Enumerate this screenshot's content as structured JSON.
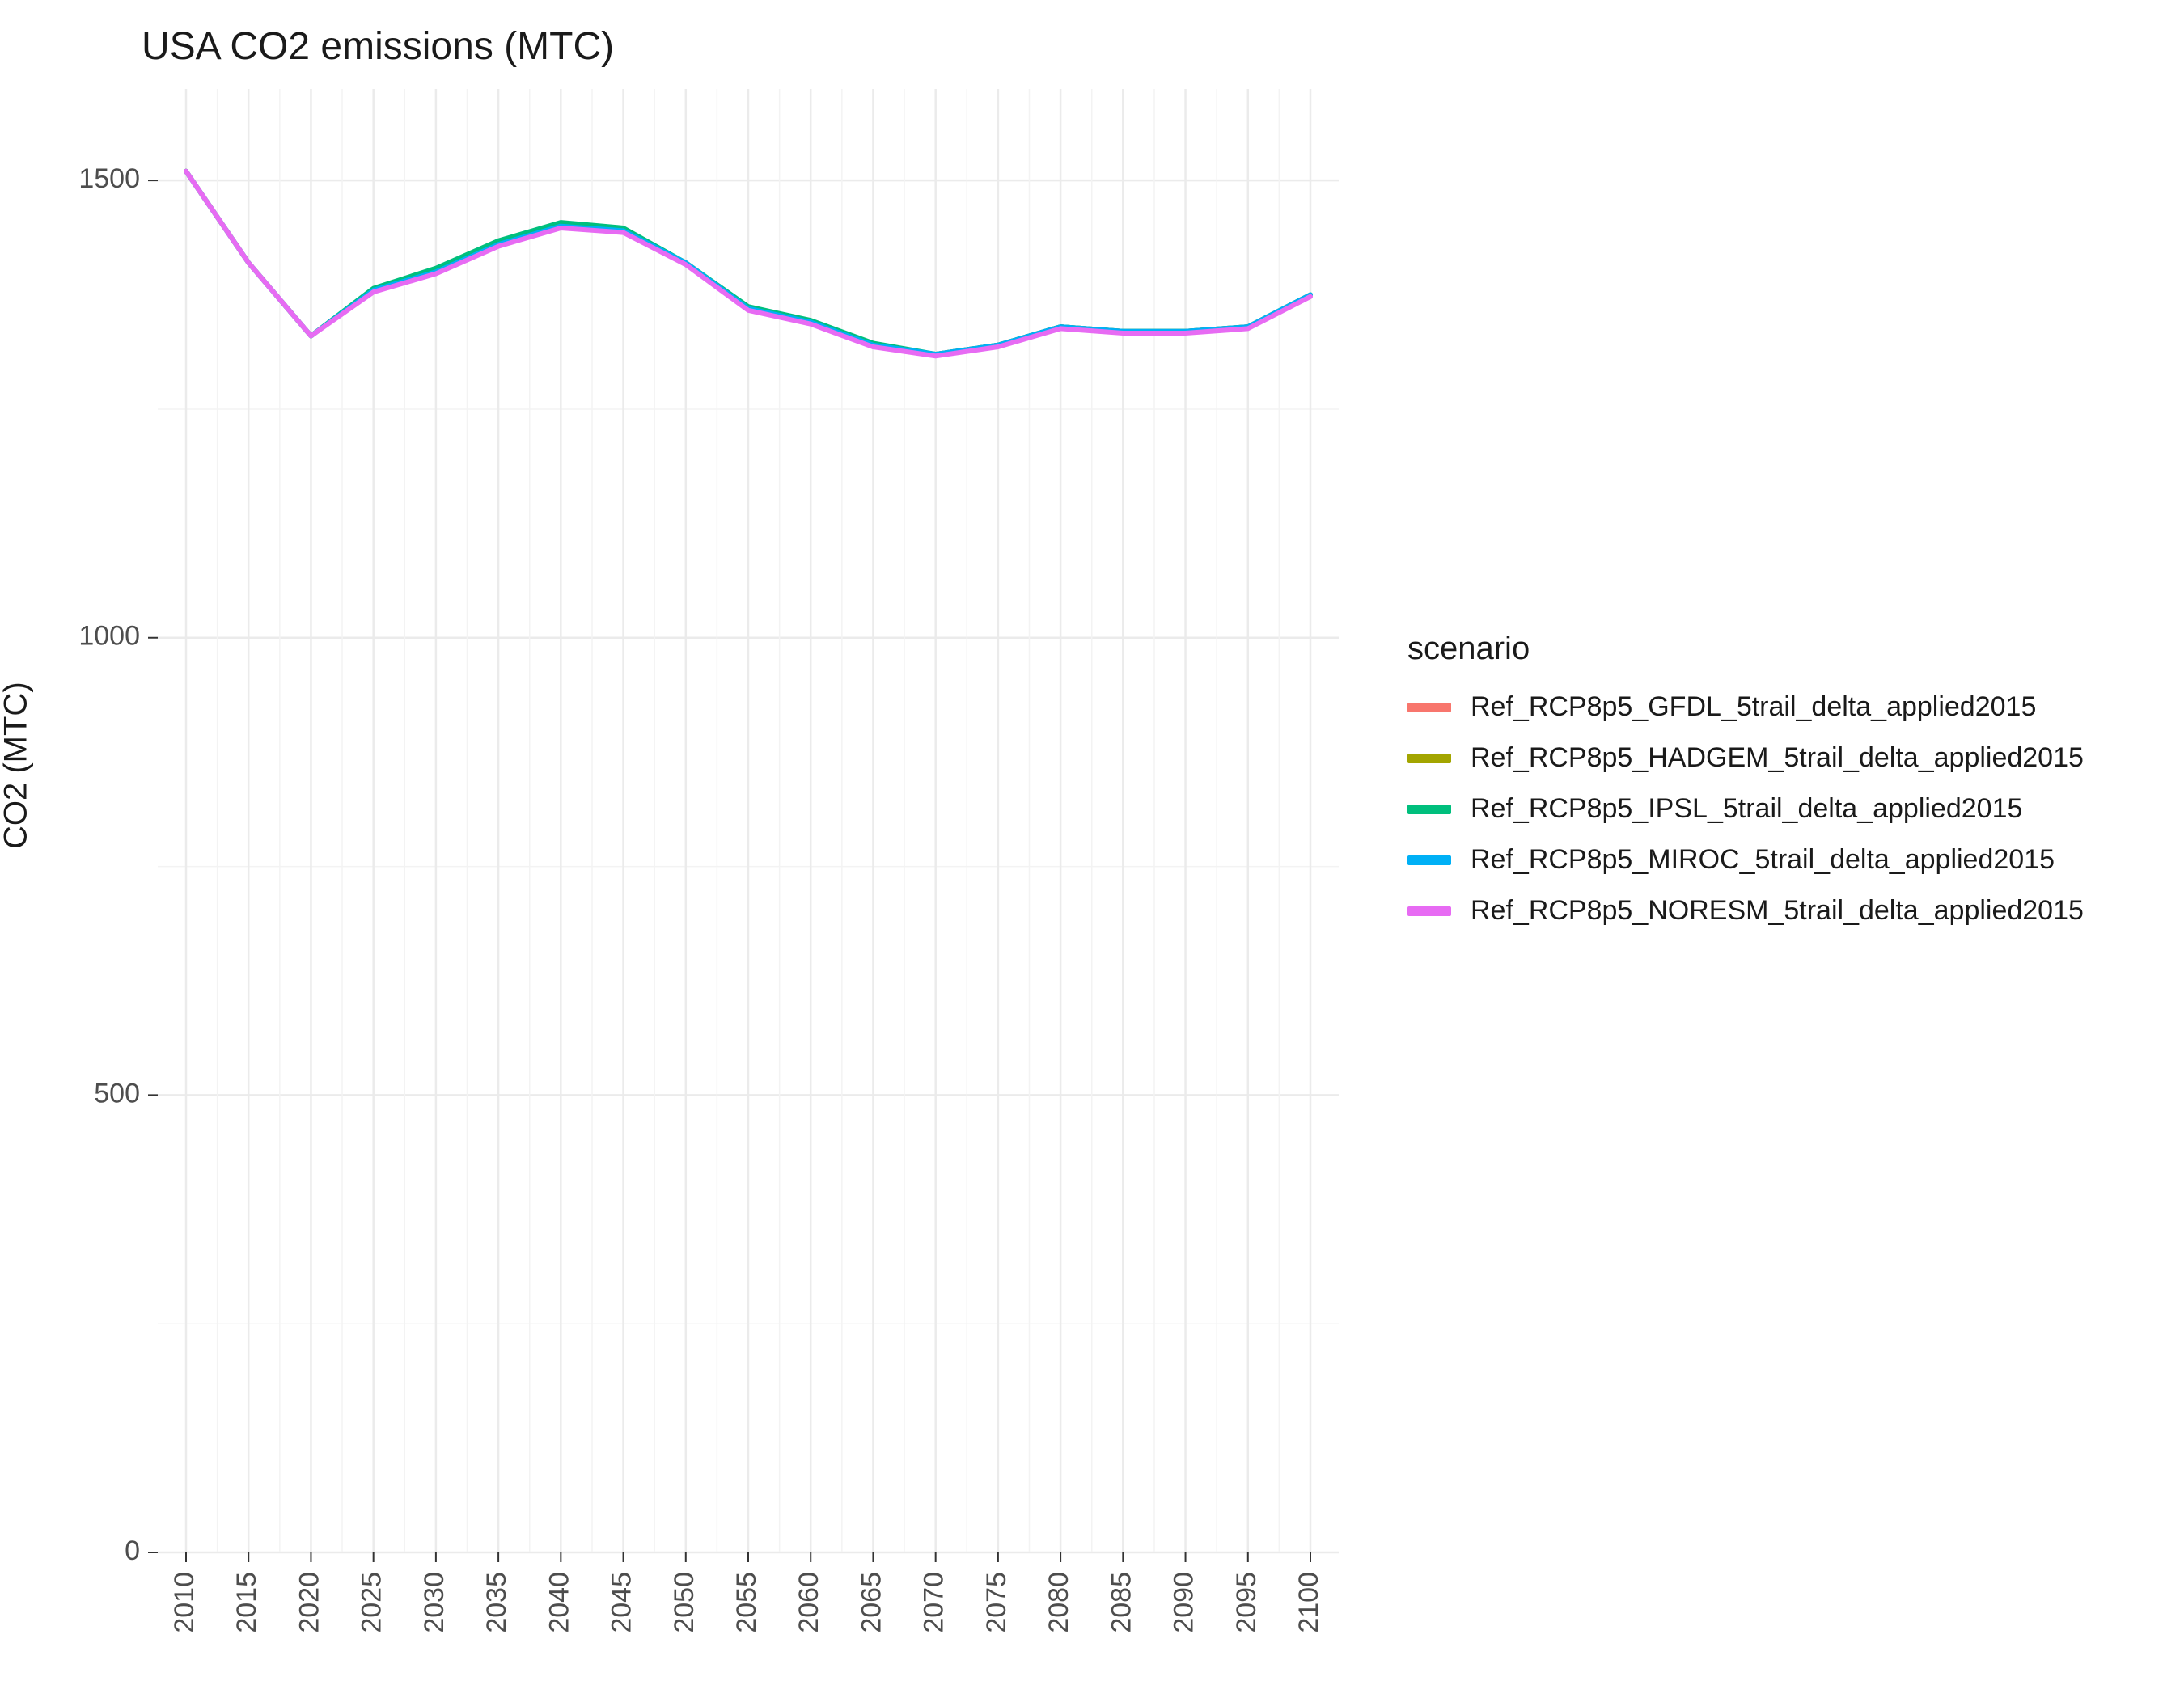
{
  "chart_data": {
    "type": "line",
    "title": "USA CO2 emissions (MTC)",
    "xlabel": "",
    "ylabel": "CO2 (MTC)",
    "ylim": [
      0,
      1600
    ],
    "yticks": [
      0,
      500,
      1000,
      1500
    ],
    "x": [
      2010,
      2015,
      2020,
      2025,
      2030,
      2035,
      2040,
      2045,
      2050,
      2055,
      2060,
      2065,
      2070,
      2075,
      2080,
      2085,
      2090,
      2095,
      2100
    ],
    "legend_title": "scenario",
    "series": [
      {
        "name": "Ref_RCP8p5_GFDL_5trail_delta_applied2015",
        "color": "#F8766D",
        "values": [
          1510,
          1410,
          1330,
          1380,
          1400,
          1430,
          1450,
          1445,
          1410,
          1360,
          1345,
          1320,
          1310,
          1320,
          1340,
          1335,
          1335,
          1340,
          1375
        ]
      },
      {
        "name": "Ref_RCP8p5_HADGEM_5trail_delta_applied2015",
        "color": "#A3A500",
        "values": [
          1510,
          1410,
          1330,
          1380,
          1400,
          1430,
          1450,
          1445,
          1410,
          1360,
          1345,
          1320,
          1310,
          1320,
          1340,
          1335,
          1335,
          1340,
          1375
        ]
      },
      {
        "name": "Ref_RCP8p5_IPSL_5trail_delta_applied2015",
        "color": "#00BF7D",
        "values": [
          1510,
          1410,
          1330,
          1382,
          1404,
          1434,
          1454,
          1448,
          1410,
          1362,
          1347,
          1322,
          1310,
          1320,
          1340,
          1335,
          1335,
          1340,
          1375
        ]
      },
      {
        "name": "Ref_RCP8p5_MIROC_5trail_delta_applied2015",
        "color": "#00B0F6",
        "values": [
          1510,
          1410,
          1330,
          1380,
          1400,
          1430,
          1450,
          1445,
          1410,
          1360,
          1345,
          1320,
          1310,
          1320,
          1340,
          1335,
          1335,
          1340,
          1375
        ]
      },
      {
        "name": "Ref_RCP8p5_NORESM_5trail_delta_applied2015",
        "color": "#E76BF3",
        "values": [
          1510,
          1410,
          1330,
          1378,
          1398,
          1428,
          1448,
          1443,
          1408,
          1358,
          1343,
          1318,
          1308,
          1318,
          1338,
          1333,
          1333,
          1338,
          1373
        ]
      }
    ]
  }
}
